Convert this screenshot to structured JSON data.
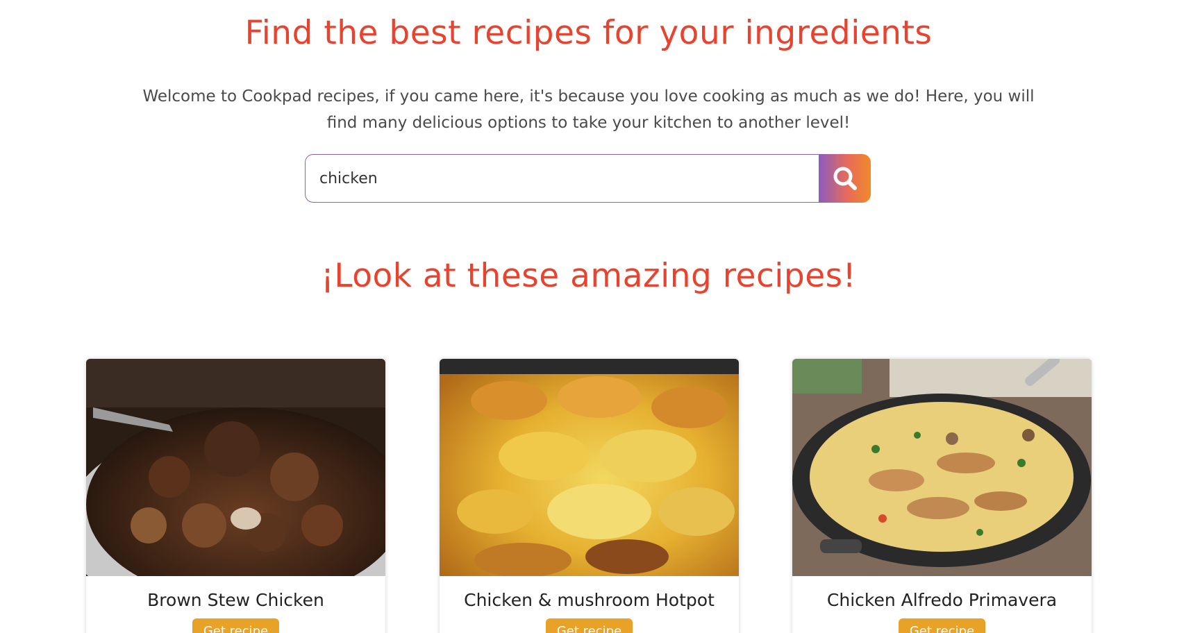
{
  "hero": {
    "title": "Find the best recipes for your ingredients",
    "subtitle": "Welcome to Cookpad recipes, if you came here, it's because you love cooking as much as we do! Here, you will find many delicious options to take your kitchen to another level!"
  },
  "search": {
    "value": "chicken",
    "button_icon": "search-icon"
  },
  "recipes_section": {
    "title": "¡Look at these amazing recipes!",
    "cards": [
      {
        "title": "Brown Stew Chicken",
        "button_label": "Get recipe"
      },
      {
        "title": "Chicken & mushroom Hotpot",
        "button_label": "Get recipe"
      },
      {
        "title": "Chicken Alfredo Primavera",
        "button_label": "Get recipe"
      }
    ]
  },
  "colors": {
    "accent_red": "#e8432e",
    "button_orange": "#e9a228",
    "search_gradient_start": "#8a5cc0",
    "search_gradient_end": "#f08a2a"
  }
}
